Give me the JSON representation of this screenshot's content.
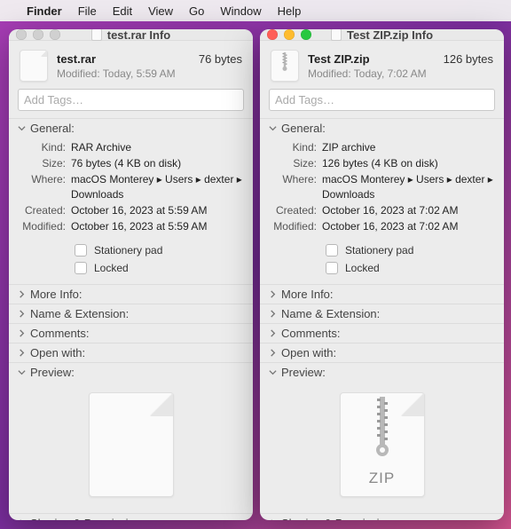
{
  "menubar": {
    "apple": "",
    "app": "Finder",
    "items": [
      "File",
      "Edit",
      "View",
      "Go",
      "Window",
      "Help"
    ]
  },
  "windows": [
    {
      "active": false,
      "title": "test.rar Info",
      "file_name": "test.rar",
      "file_size": "76 bytes",
      "modified_short": "Modified: Today, 5:59 AM",
      "tags_placeholder": "Add Tags…",
      "general_label": "General:",
      "kv": {
        "kind_label": "Kind:",
        "kind": "RAR Archive",
        "size_label": "Size:",
        "size": "76 bytes (4 KB on disk)",
        "where_label": "Where:",
        "where": "macOS Monterey ▸ Users ▸ dexter ▸ Downloads",
        "created_label": "Created:",
        "created": "October 16, 2023 at 5:59 AM",
        "modified_label": "Modified:",
        "modified": "October 16, 2023 at 5:59 AM"
      },
      "stationery_label": "Stationery pad",
      "locked_label": "Locked",
      "sections": {
        "more_info": "More Info:",
        "name_ext": "Name & Extension:",
        "comments": "Comments:",
        "open_with": "Open with:",
        "preview": "Preview:",
        "sharing": "Sharing & Permissions:"
      },
      "preview_type": "blank"
    },
    {
      "active": true,
      "title": "Test ZIP.zip Info",
      "file_name": "Test ZIP.zip",
      "file_size": "126 bytes",
      "modified_short": "Modified: Today, 7:02 AM",
      "tags_placeholder": "Add Tags…",
      "general_label": "General:",
      "kv": {
        "kind_label": "Kind:",
        "kind": "ZIP archive",
        "size_label": "Size:",
        "size": "126 bytes (4 KB on disk)",
        "where_label": "Where:",
        "where": "macOS Monterey ▸ Users ▸ dexter ▸ Downloads",
        "created_label": "Created:",
        "created": "October 16, 2023 at 7:02 AM",
        "modified_label": "Modified:",
        "modified": "October 16, 2023 at 7:02 AM"
      },
      "stationery_label": "Stationery pad",
      "locked_label": "Locked",
      "sections": {
        "more_info": "More Info:",
        "name_ext": "Name & Extension:",
        "comments": "Comments:",
        "open_with": "Open with:",
        "preview": "Preview:",
        "sharing": "Sharing & Permissions:"
      },
      "preview_type": "zip",
      "preview_label": "ZIP"
    }
  ]
}
